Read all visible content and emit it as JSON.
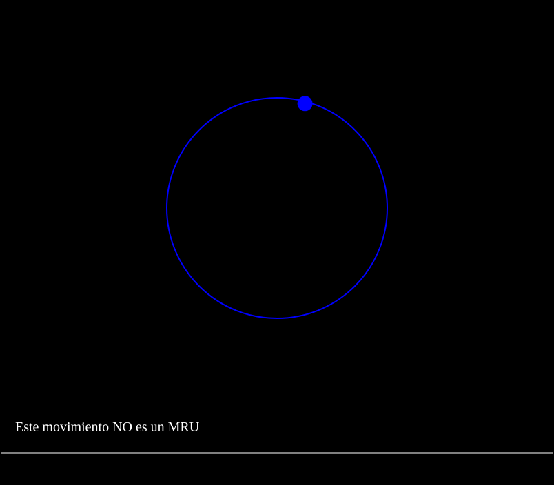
{
  "caption": {
    "text": "Este movimiento NO es un MRU"
  },
  "colors": {
    "background": "#000000",
    "orbit": "#0000ff",
    "particle": "#0000ff",
    "caption_text": "#ffffff",
    "divider": "#808080"
  },
  "motion": {
    "orbit_shape": "circle",
    "particle_angle_deg": 75
  }
}
